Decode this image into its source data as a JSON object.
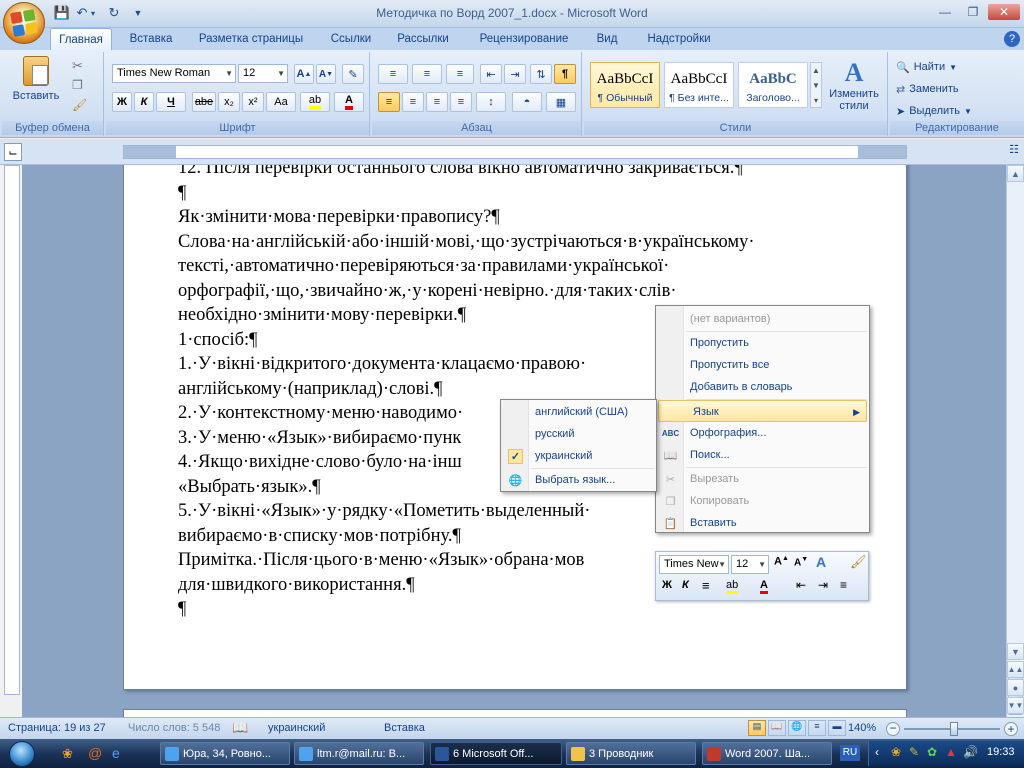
{
  "app": {
    "window_title": "Методичка по Ворд 2007_1.docx - Microsoft Word",
    "help_glyph": "?"
  },
  "tabs": [
    "Главная",
    "Вставка",
    "Разметка страницы",
    "Ссылки",
    "Рассылки",
    "Рецензирование",
    "Вид",
    "Надстройки"
  ],
  "ribbon": {
    "clipboard": {
      "label": "Буфер обмена",
      "paste_label": "Вставить"
    },
    "font": {
      "label": "Шрифт",
      "font_name": "Times New Roman",
      "font_size": "12",
      "bold": "Ж",
      "italic": "К",
      "underline": "Ч",
      "strike": "abe",
      "sub": "x₂",
      "sup": "x²",
      "case": "Aa"
    },
    "paragraph": {
      "label": "Абзац"
    },
    "styles": {
      "label": "Стили",
      "items": [
        {
          "sample": "AaBbCcI",
          "name": "¶ Обычный"
        },
        {
          "sample": "AaBbCcI",
          "name": "¶ Без инте..."
        },
        {
          "sample": "AaBbC",
          "name": "Заголово..."
        }
      ],
      "change_styles": "Изменить стили"
    },
    "editing": {
      "label": "Редактирование",
      "find": "Найти",
      "replace": "Заменить",
      "select": "Выделить"
    }
  },
  "document": {
    "lines": [
      "12. Після перевірки останнього слова вікно автоматично закривається.¶",
      "¶",
      "Як·змінити·мова·перевірки·правопису?¶",
      "Слова·на·англійській·або·іншій·мові,·що·зустрічаються·в·українському·",
      "тексті,·автоматично·перевіряються·за·правилами·української·",
      "орфографії,·що,·звичайно·ж,·у·корені·невірно.·для·таких·слів·",
      "необхідно·змінити·мову·перевірки.¶",
      "1·спосіб:¶",
      "1.·У·вікні·відкритого·документа·клацаємо·правою·",
      "англійському·(наприклад)·слові.¶",
      "2.·У·контекстному·меню·наводимо·",
      "3.·У·меню·«Язык»·вибираємо·пунк",
      "4.·Якщо·вихідне·слово·було·на·інш",
      "«Выбрать·язык».¶",
      "5.·У·вікні·«Язык»·у·рядку·«Пометить·выделенный·",
      "вибираємо·в·списку·мов·потрібну.¶",
      "Примітка.·Після·цього·в·меню·«Язык»·обрана·мов",
      "для·швидкого·використання.¶",
      "¶"
    ]
  },
  "context_menu": {
    "no_suggestions": "(нет вариантов)",
    "skip": "Пропустить",
    "skip_all": "Пропустить все",
    "add_to_dict": "Добавить в словарь",
    "language": "Язык",
    "spelling": "Орфография...",
    "search": "Поиск...",
    "cut": "Вырезать",
    "copy": "Копировать",
    "paste": "Вставить"
  },
  "language_submenu": {
    "english": "английский (США)",
    "russian": "русский",
    "ukrainian": "украинский",
    "choose": "Выбрать язык...",
    "checked": "украинский"
  },
  "mini_toolbar": {
    "font_name": "Times New",
    "font_size": "12"
  },
  "status": {
    "page": "Страница: 19 из 27",
    "words": "Число слов: 5 548",
    "language": "украинский",
    "mode": "Вставка",
    "zoom": "140%"
  },
  "taskbar": {
    "items": [
      "Юра, 34, Ровно...",
      "ltm.r@mail.ru: В...",
      "6 Microsoft Off...",
      "3 Проводник",
      "Word 2007. Ша..."
    ],
    "lang": "RU",
    "time": "19:33"
  },
  "colors": {
    "accent": "#15428b",
    "ribbon": "#d6e3f4",
    "highlight": "#ffe6a0"
  }
}
